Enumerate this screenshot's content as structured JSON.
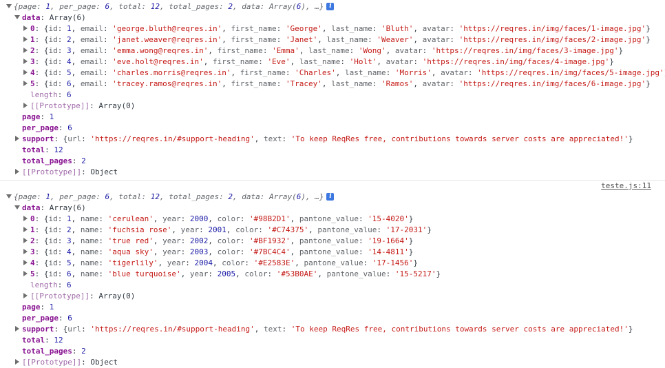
{
  "console": {
    "source_link": "teste.js:11",
    "logs": [
      {
        "summary": "{page: 1, per_page: 6, total: 12, total_pages: 2, data: Array(6), …}",
        "data_label": "data",
        "data_type": "Array(6)",
        "items": [
          "{id: 1, email: 'george.bluth@reqres.in', first_name: 'George', last_name: 'Bluth', avatar: 'https://reqres.in/img/faces/1-image.jpg'}",
          "{id: 2, email: 'janet.weaver@reqres.in', first_name: 'Janet', last_name: 'Weaver', avatar: 'https://reqres.in/img/faces/2-image.jpg'}",
          "{id: 3, email: 'emma.wong@reqres.in', first_name: 'Emma', last_name: 'Wong', avatar: 'https://reqres.in/img/faces/3-image.jpg'}",
          "{id: 4, email: 'eve.holt@reqres.in', first_name: 'Eve', last_name: 'Holt', avatar: 'https://reqres.in/img/faces/4-image.jpg'}",
          "{id: 5, email: 'charles.morris@reqres.in', first_name: 'Charles', last_name: 'Morris', avatar: 'https://reqres.in/img/faces/5-image.jpg'}",
          "{id: 6, email: 'tracey.ramos@reqres.in', first_name: 'Tracey', last_name: 'Ramos', avatar: 'https://reqres.in/img/faces/6-image.jpg'}"
        ],
        "length": "6",
        "array_proto": "Array(0)",
        "page": "1",
        "per_page": "6",
        "support": "{url: 'https://reqres.in/#support-heading', text: 'To keep ReqRes free, contributions towards server costs are appreciated!'}",
        "total": "12",
        "total_pages": "2",
        "object_proto": "Object"
      },
      {
        "summary": "{page: 1, per_page: 6, total: 12, total_pages: 2, data: Array(6), …}",
        "data_label": "data",
        "data_type": "Array(6)",
        "items": [
          "{id: 1, name: 'cerulean', year: 2000, color: '#98B2D1', pantone_value: '15-4020'}",
          "{id: 2, name: 'fuchsia rose', year: 2001, color: '#C74375', pantone_value: '17-2031'}",
          "{id: 3, name: 'true red', year: 2002, color: '#BF1932', pantone_value: '19-1664'}",
          "{id: 4, name: 'aqua sky', year: 2003, color: '#7BC4C4', pantone_value: '14-4811'}",
          "{id: 5, name: 'tigerlily', year: 2004, color: '#E2583E', pantone_value: '17-1456'}",
          "{id: 6, name: 'blue turquoise', year: 2005, color: '#53B0AE', pantone_value: '15-5217'}"
        ],
        "length": "6",
        "array_proto": "Array(0)",
        "page": "1",
        "per_page": "6",
        "support": "{url: 'https://reqres.in/#support-heading', text: 'To keep ReqRes free, contributions towards server costs are appreciated!'}",
        "total": "12",
        "total_pages": "2",
        "object_proto": "Object"
      }
    ],
    "labels": {
      "length": "length",
      "proto": "[[Prototype]]",
      "page": "page",
      "per_page": "per_page",
      "support": "support",
      "total": "total",
      "total_pages": "total_pages"
    },
    "colors": {
      "key": "#881391",
      "number": "#1a1aa6",
      "string": "#c41a16",
      "info_badge": "#3d78e0"
    },
    "icons": {
      "info": "i"
    }
  }
}
